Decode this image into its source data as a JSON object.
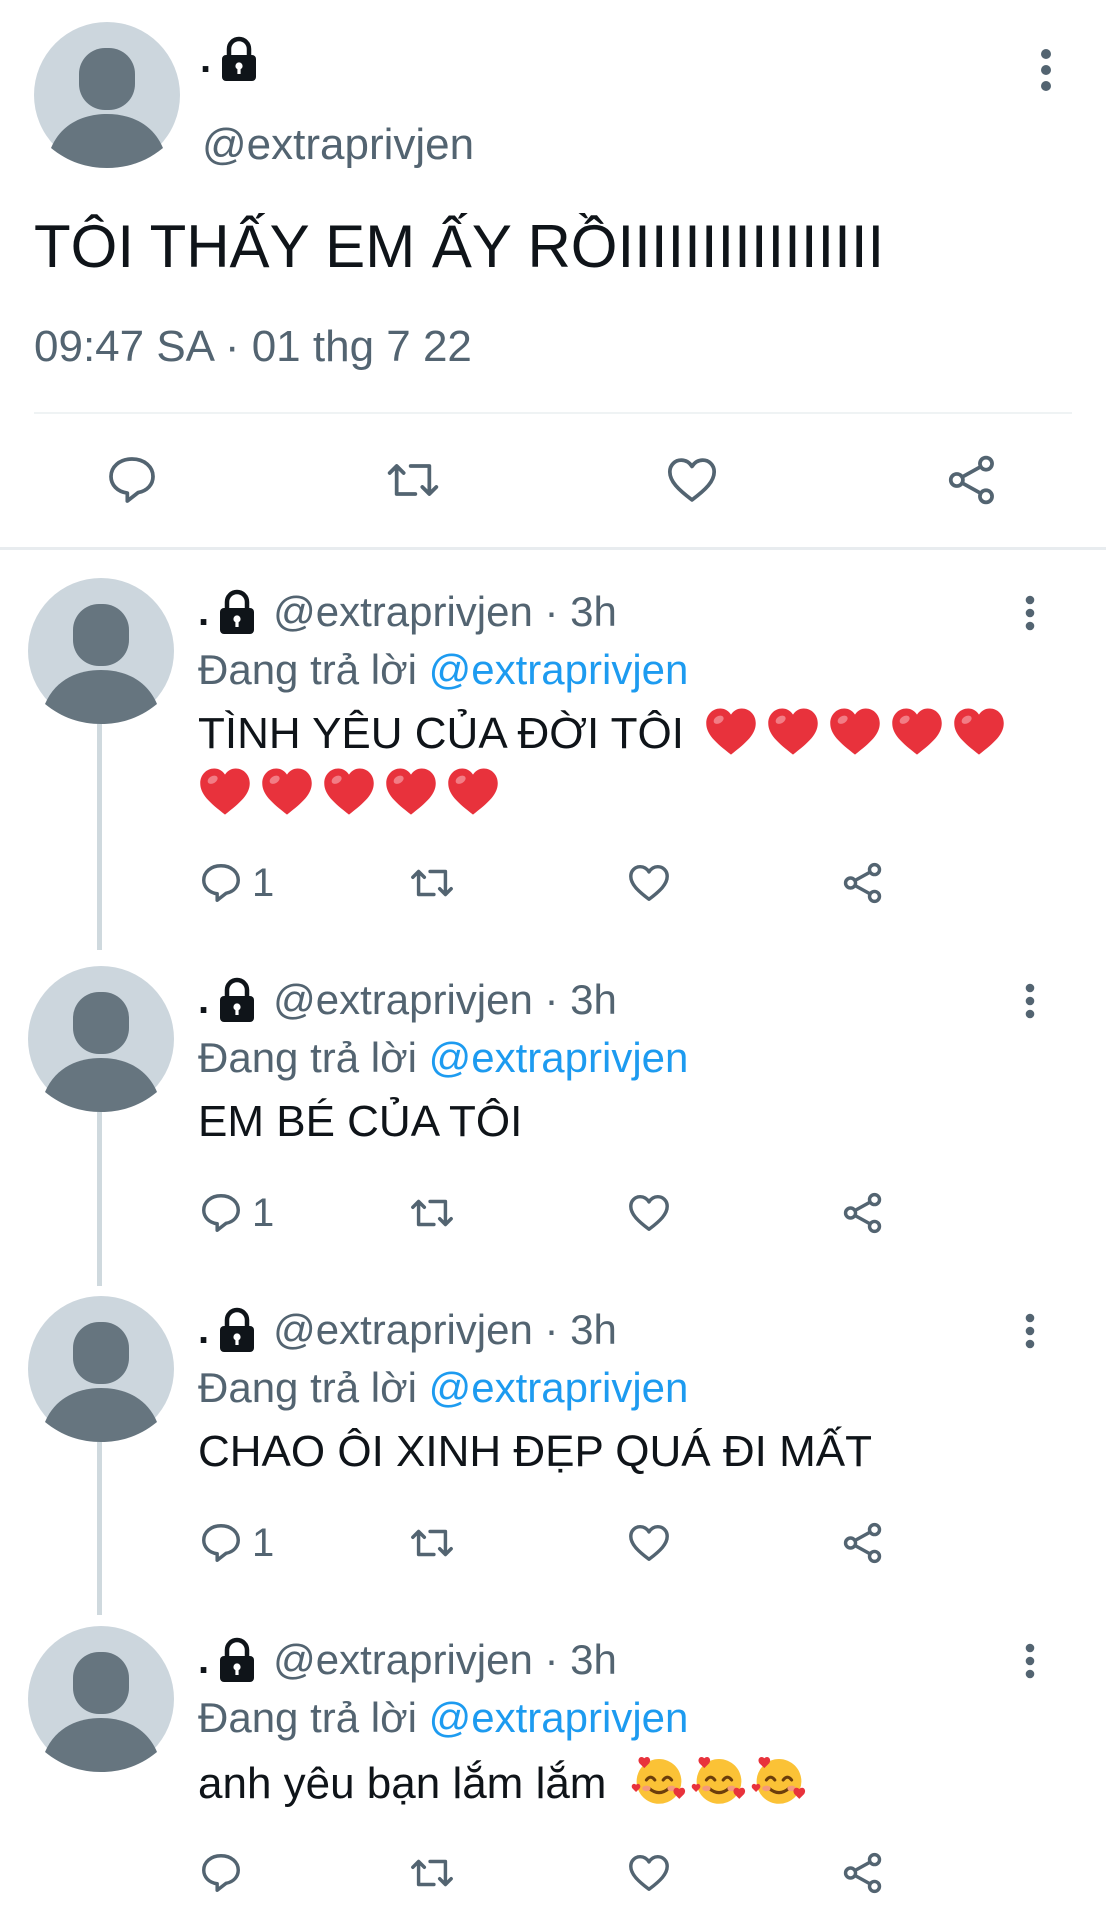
{
  "main_tweet": {
    "display_name": ".",
    "handle": "@extraprivjen",
    "text": "TÔI THẤY EM ẤY RỒIIIIIIIIIIIIIIII",
    "timestamp": "09:47 SA · 01 thg 7 22",
    "actions": [
      "reply-icon",
      "retweet-icon",
      "like-icon",
      "share-icon"
    ]
  },
  "replies": [
    {
      "display_name": ".",
      "handle_time": "@extraprivjen · 3h",
      "replying_prefix": "Đang trả lời",
      "replying_to": "@extraprivjen",
      "text": "TÌNH YÊU CỦA ĐỜI TÔI",
      "emoji": "❤️❤️❤️❤️❤️❤️❤️❤️❤️❤️",
      "reply_count": "1"
    },
    {
      "display_name": ".",
      "handle_time": "@extraprivjen · 3h",
      "replying_prefix": "Đang trả lời",
      "replying_to": "@extraprivjen",
      "text": "EM BÉ CỦA TÔI",
      "reply_count": "1"
    },
    {
      "display_name": ".",
      "handle_time": "@extraprivjen · 3h",
      "replying_prefix": "Đang trả lời",
      "replying_to": "@extraprivjen",
      "text": "CHAO ÔI XINH ĐẸP QUÁ ĐI MẤT",
      "reply_count": "1"
    },
    {
      "display_name": ".",
      "handle_time": "@extraprivjen · 3h",
      "replying_prefix": "Đang trả lời",
      "replying_to": "@extraprivjen",
      "text": "anh yêu bạn lắm lắm",
      "emoji": "🥰🥰🥰",
      "reply_count": ""
    }
  ],
  "colors": {
    "text": "#0f1419",
    "secondary": "#536471",
    "link": "#1d9bf0",
    "avatar_bg": "#ccd6dd",
    "avatar_fg": "#66757f",
    "thread_line": "#cfd9de",
    "heart": "#e8323c"
  }
}
